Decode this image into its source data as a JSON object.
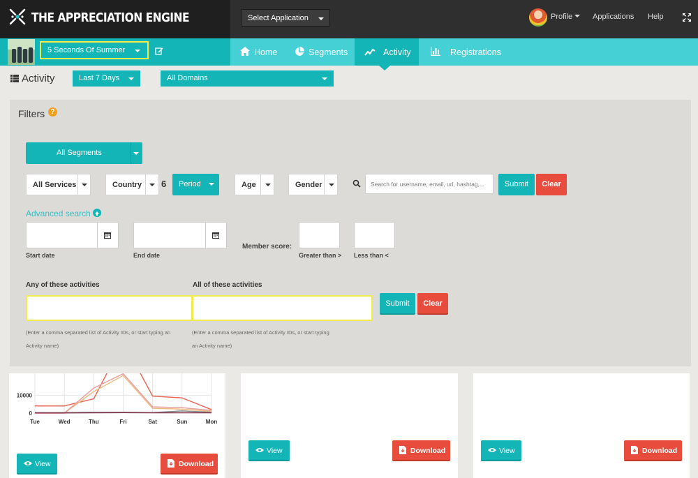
{
  "header": {
    "brand": "THE APPRECIATION ENGINE",
    "app_select": "Select Application",
    "profile": "Profile",
    "applications": "Applications",
    "help": "Help"
  },
  "subnav": {
    "artist": "5 Seconds Of Summer",
    "tabs": [
      {
        "label": "Home",
        "icon": "home-icon"
      },
      {
        "label": "Segments",
        "icon": "pie-chart-icon"
      },
      {
        "label": "Activity",
        "icon": "line-chart-icon",
        "active": true
      },
      {
        "label": "Registrations",
        "icon": "bar-chart-icon"
      }
    ]
  },
  "activity_bar": {
    "title": "Activity",
    "range": "Last 7 Days",
    "domain": "All Domains"
  },
  "filters": {
    "title": "Filters",
    "segments": "All Segments",
    "services": "All Services",
    "country": "Country",
    "country_count": "6",
    "period": "Period",
    "age": "Age",
    "gender": "Gender",
    "search_placeholder": "Search for username, email, url, hashtag,...",
    "submit": "Submit",
    "clear": "Clear",
    "advanced_search": "Advanced search",
    "start_date": "Start date",
    "end_date": "End date",
    "member_score": "Member score:",
    "greater_than": "Greater than >",
    "less_than": "Less than <",
    "any_activities": "Any of these activities",
    "all_activities": "All of these activities",
    "hint_any": "(Enter a comma separated list of Activity IDs, or start typing an Activity name)",
    "hint_all": "(Enter a comma separated list of Activity IDs, or start typing an Activity name)",
    "submit2": "Submit",
    "clear2": "Clear"
  },
  "cards": {
    "view": "View",
    "download": "Download"
  },
  "chart_data": {
    "type": "line",
    "categories": [
      "Tue",
      "Wed",
      "Thu",
      "Fri",
      "Sat",
      "Sun",
      "Mon"
    ],
    "y_ticks": [
      "10000",
      "0"
    ],
    "ylim": [
      0,
      20000
    ],
    "series": [
      {
        "color": "#e8695a",
        "values": [
          4000,
          4000,
          8000,
          40000,
          9500,
          8500,
          2000
        ]
      },
      {
        "color": "#eebc86",
        "values": [
          0,
          0,
          12000,
          21000,
          2700,
          2200,
          1000
        ]
      },
      {
        "color": "#e8a0a0",
        "values": [
          0,
          0,
          14000,
          22000,
          3500,
          3000,
          1500
        ]
      },
      {
        "color": "#7f8c8d",
        "values": [
          300,
          300,
          500,
          500,
          300,
          1200,
          500
        ]
      },
      {
        "color": "#8e3b52",
        "values": [
          100,
          100,
          200,
          300,
          200,
          200,
          200
        ]
      }
    ]
  }
}
